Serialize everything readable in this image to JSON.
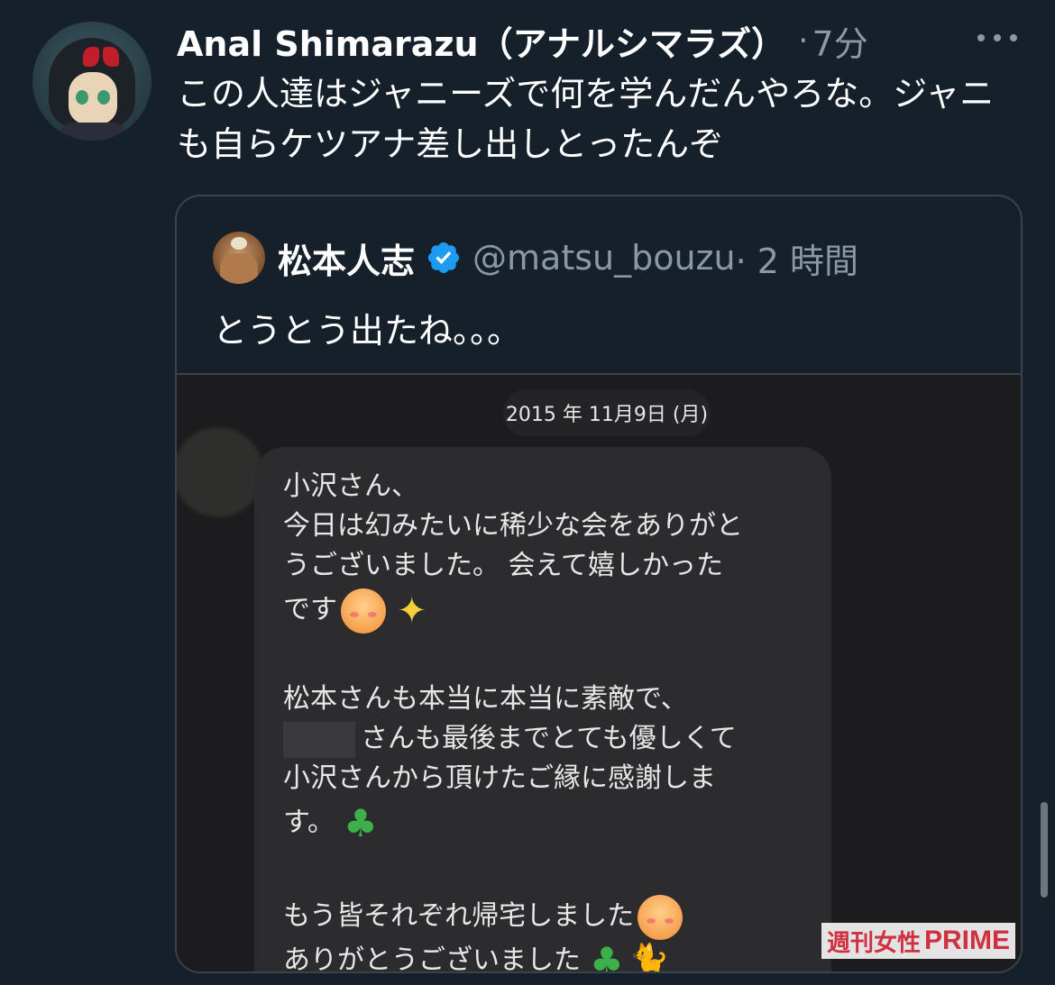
{
  "tweet": {
    "display_name": "Anal Shimarazu（アナルシマラズ）",
    "dot": "·",
    "time": "7分",
    "text": "この人達はジャニーズで何を学んだんやろな。ジャニも自らケツアナ差し出しとったんぞ"
  },
  "quote": {
    "name": "松本人志",
    "handle": "@matsu_bouzu",
    "time": "· 2 時間",
    "text": "とうとう出たね。。。",
    "image": {
      "date": "2015 年 11月9日 (月)",
      "lines": [
        "小沢さん、",
        "今日は幻みたいに稀少な会をありがと",
        "うございました。 会えて嬉しかった",
        "です",
        "松本さんも本当に本当に素敵で、",
        "さんも最後までとても優しくて",
        "小沢さんから頂けたご縁に感謝しま",
        "す。",
        "もう皆それぞれ帰宅しました",
        "ありがとうございました"
      ],
      "watermark_jp": "週刊女性",
      "watermark_en": "PRIME"
    }
  },
  "icons": {
    "more": "more-horizontal-icon",
    "verified": "verified-badge-icon",
    "verified_color": "#1d9bf0"
  }
}
